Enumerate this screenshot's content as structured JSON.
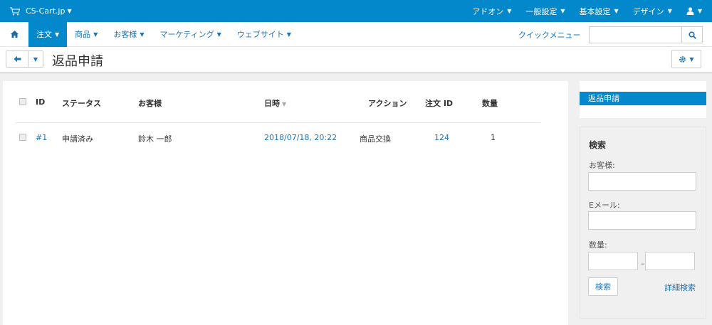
{
  "topbar": {
    "brand": "CS-Cart.jp",
    "menu": [
      "アドオン",
      "一般設定",
      "基本設定",
      "デザイン"
    ]
  },
  "navbar": {
    "items": [
      "注文",
      "商品",
      "お客様",
      "マーケティング",
      "ウェブサイト"
    ],
    "quick_menu": "クイックメニュー",
    "search_placeholder": ""
  },
  "title": "返品申請",
  "table": {
    "headers": [
      "ID",
      "ステータス",
      "お客様",
      "日時",
      "アクション",
      "注文 ID",
      "数量"
    ],
    "rows": [
      {
        "id": "#1",
        "status": "申請済み",
        "customer": "鈴木 一郎",
        "date": "2018/07/18, 20:22",
        "action": "商品交換",
        "order_id": "124",
        "qty": "1"
      }
    ]
  },
  "sidebar": {
    "active_item": "返品申請",
    "search": {
      "title": "検索",
      "customer_label": "お客様:",
      "email_label": "Eメール:",
      "qty_label": "数量:",
      "qty_separator": "–",
      "search_button": "検索",
      "advanced_link": "詳細検索"
    }
  },
  "colors": {
    "primary": "#0388cc",
    "link": "#1f74b5",
    "background": "#f0f0f0"
  }
}
